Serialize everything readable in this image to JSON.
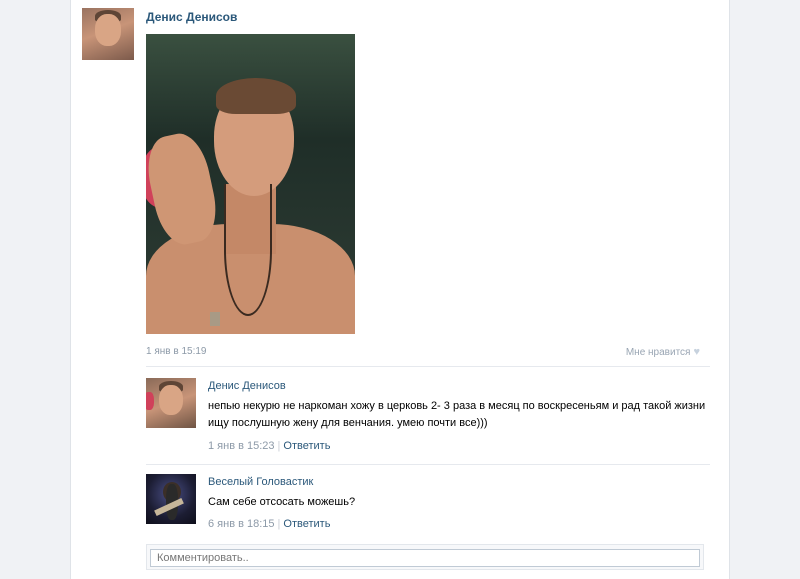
{
  "post": {
    "author": "Денис Денисов",
    "time": "1 янв в 15:19",
    "like_label": "Мне нравится"
  },
  "comments": [
    {
      "author": "Денис Денисов",
      "text": "непью некурю не наркоман хожу в церковь 2- 3 раза в месяц по воскресеньям и рад такой жизни ищу послушную жену для венчания. умею почти все)))",
      "time": "1 янв в 15:23",
      "reply_label": "Ответить"
    },
    {
      "author": "Веселый Головастик",
      "text": "Сам себе отсосать можешь?",
      "time": "6 янв в 18:15",
      "reply_label": "Ответить"
    }
  ],
  "composer": {
    "placeholder": "Комментировать.."
  },
  "icons": {
    "like": "heart-icon"
  },
  "colors": {
    "link": "#2b587a",
    "meta": "#8d9aa8"
  }
}
